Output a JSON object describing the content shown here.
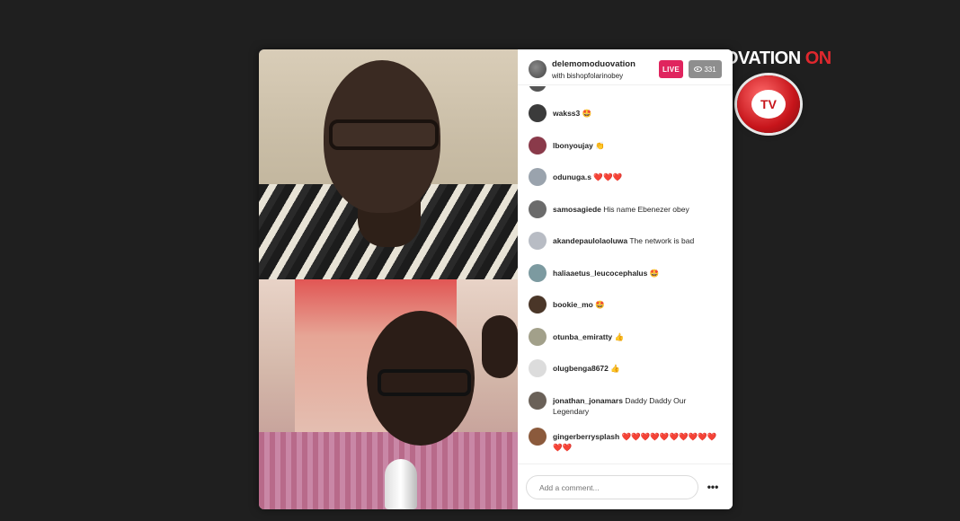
{
  "brand": {
    "text_main": "OVATION",
    "text_accent": "ON",
    "logo_text": "TV",
    "accent_color": "#e0282e"
  },
  "live": {
    "host_name": "delemomoduovation",
    "with_text": "with bishopfolarinobey",
    "live_badge": "LIVE",
    "viewer_count": "331",
    "live_color": "#e0245e"
  },
  "comments": [
    {
      "user": "wakss3",
      "text": "🤩",
      "avatar_color": "#3b3b3b"
    },
    {
      "user": "lbonyoujay",
      "text": "👏",
      "avatar_color": "#8a3a4a"
    },
    {
      "user": "odunuga.s",
      "text": "❤️❤️❤️",
      "avatar_color": "#9aa3ad"
    },
    {
      "user": "samosagiede",
      "text": "His name Ebenezer obey",
      "avatar_color": "#6b6b6b"
    },
    {
      "user": "akandepaulolaoluwa",
      "text": "The network is bad",
      "avatar_color": "#b8bcc4"
    },
    {
      "user": "haliaaetus_leucocephalus",
      "text": "🤩",
      "avatar_color": "#7c9aa0"
    },
    {
      "user": "bookie_mo",
      "text": "🤩",
      "avatar_color": "#4a3628"
    },
    {
      "user": "otunba_emiratty",
      "text": "👍",
      "avatar_color": "#a2a08a"
    },
    {
      "user": "olugbenga8672",
      "text": "👍",
      "avatar_color": "#dcdcdc"
    },
    {
      "user": "jonathan_jonamars",
      "text": "Daddy Daddy Our Legendary",
      "avatar_color": "#6a6158"
    },
    {
      "user": "gingerberrysplash",
      "text": "❤️❤️❤️❤️❤️❤️❤️❤️❤️❤️❤️❤️",
      "avatar_color": "#8b5a3c"
    }
  ],
  "footer": {
    "comment_placeholder": "Add a comment...",
    "more_label": "•••"
  },
  "icons": {
    "viewers": "eye-icon",
    "more": "more-options-icon"
  }
}
